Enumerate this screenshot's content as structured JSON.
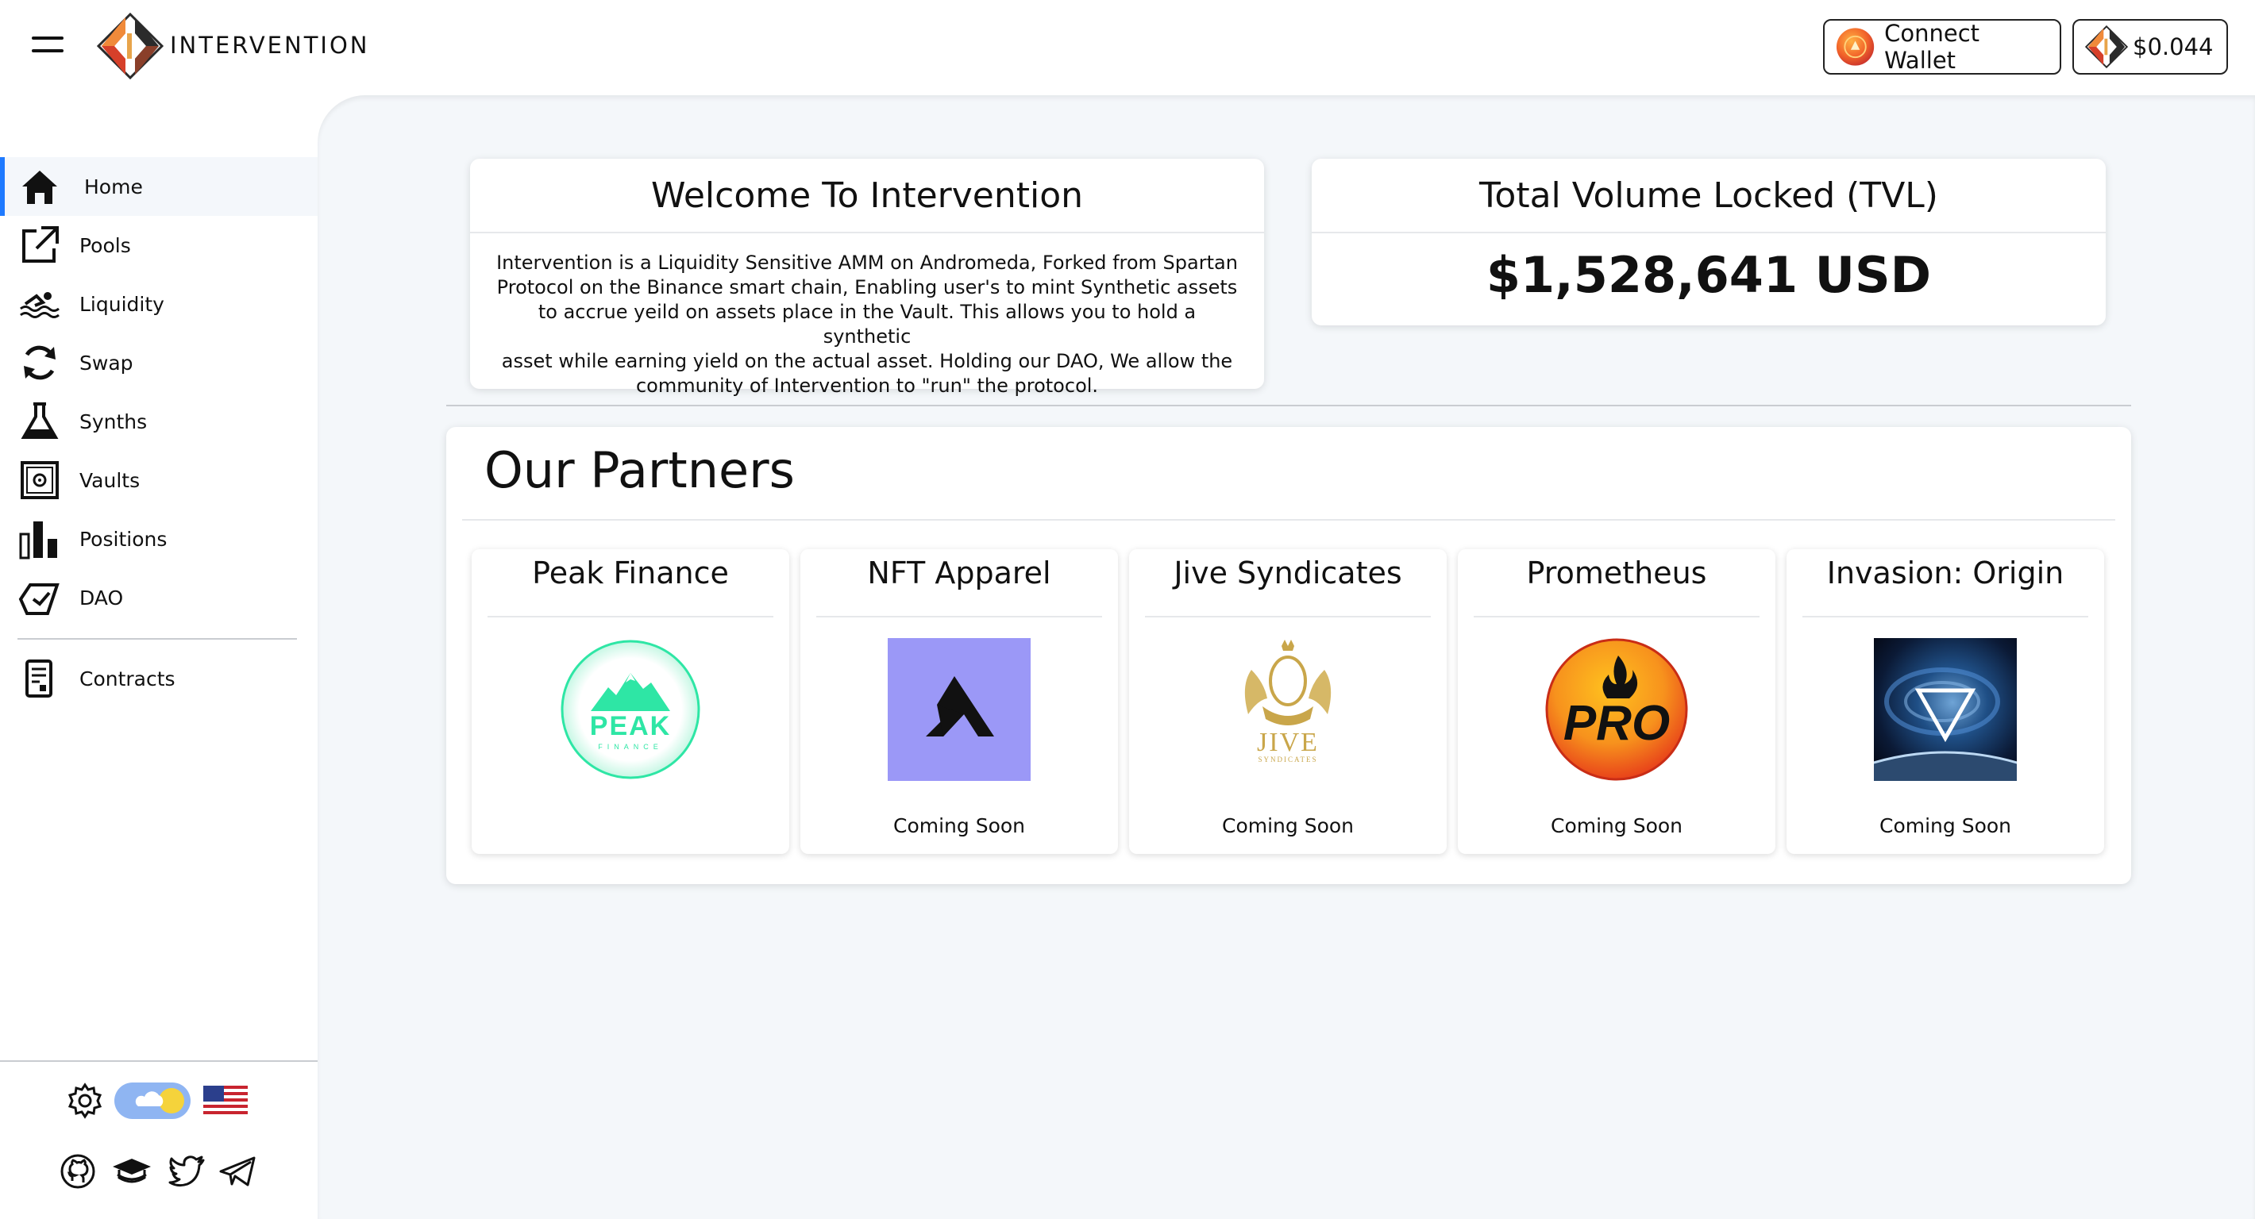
{
  "header": {
    "brand": "INTERVENTION",
    "connect_wallet": "Connect Wallet",
    "token_price": "$0.044"
  },
  "sidebar": {
    "items": [
      {
        "label": "Home",
        "icon": "home-icon",
        "active": true
      },
      {
        "label": "Pools",
        "icon": "external-link-icon"
      },
      {
        "label": "Liquidity",
        "icon": "swimmer-icon"
      },
      {
        "label": "Swap",
        "icon": "refresh-icon"
      },
      {
        "label": "Synths",
        "icon": "flask-icon"
      },
      {
        "label": "Vaults",
        "icon": "safe-icon"
      },
      {
        "label": "Positions",
        "icon": "bar-chart-icon"
      },
      {
        "label": "DAO",
        "icon": "vote-icon"
      },
      {
        "label": "Contracts",
        "icon": "document-icon"
      }
    ],
    "tools": [
      "gear-icon",
      "theme-toggle",
      "us-flag-icon"
    ],
    "socials": [
      "github-icon",
      "docs-icon",
      "twitter-icon",
      "telegram-icon"
    ]
  },
  "welcome": {
    "title": "Welcome To Intervention",
    "lines": [
      "Intervention is a Liquidity Sensitive AMM on Andromeda, Forked from Spartan",
      "Protocol on the Binance smart chain, Enabling user's to mint Synthetic assets",
      "to accrue yeild on assets place in the Vault. This allows you to hold a synthetic",
      "asset while earning yield on the actual asset. Holding our DAO, We allow the",
      "community of Intervention to \"run\" the protocol."
    ]
  },
  "tvl": {
    "title": "Total Volume Locked (TVL)",
    "value": "$1,528,641 USD"
  },
  "partners": {
    "title": "Our Partners",
    "items": [
      {
        "name": "Peak Finance",
        "status": "",
        "logo_text": "PEAK",
        "logo_subtext": "FINANCE"
      },
      {
        "name": "NFT Apparel",
        "status": "Coming Soon"
      },
      {
        "name": "Jive Syndicates",
        "status": "Coming Soon",
        "logo_text": "JIVE",
        "logo_subtext": "SYNDICATES"
      },
      {
        "name": "Prometheus",
        "status": "Coming Soon",
        "logo_text": "PRO"
      },
      {
        "name": "Invasion: Origin",
        "status": "Coming Soon"
      }
    ]
  },
  "colors": {
    "accent_blue": "#1f7aff",
    "main_bg": "#f4f7fa",
    "peak_green": "#2ee6a5",
    "nft_purple": "#9b98f7",
    "jive_gold": "#c9a64a",
    "pro_orange": "#f57c1f"
  }
}
